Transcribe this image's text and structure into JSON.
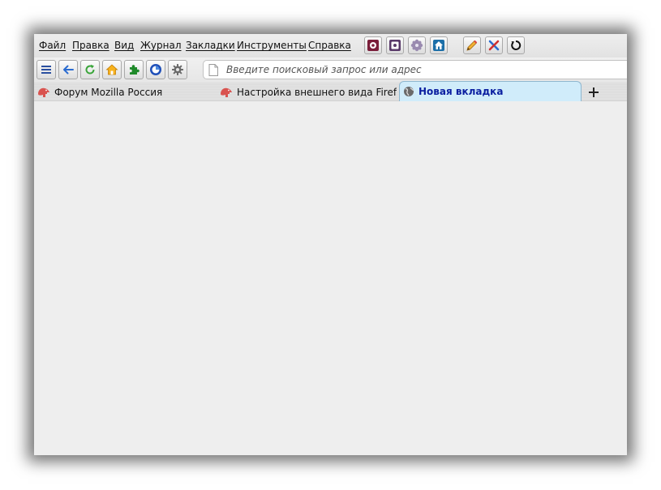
{
  "menu": {
    "items": [
      {
        "label": "Файл"
      },
      {
        "label": "Правка"
      },
      {
        "label": "Вид"
      },
      {
        "label": "Журнал"
      },
      {
        "label": "Закладки"
      },
      {
        "label": "Инструменты"
      },
      {
        "label": "Справка"
      }
    ]
  },
  "menu_toolbar": {
    "buttons": [
      {
        "icon": "settings-square-icon"
      },
      {
        "icon": "addons-square-icon"
      },
      {
        "icon": "gear-flower-icon"
      },
      {
        "icon": "home-box-icon"
      },
      {
        "icon": "pencil-icon"
      },
      {
        "icon": "tools-cross-icon"
      },
      {
        "icon": "restart-icon"
      }
    ]
  },
  "navbar": {
    "buttons": [
      {
        "icon": "menu-icon"
      },
      {
        "icon": "back-arrow-icon"
      },
      {
        "icon": "reload-icon"
      },
      {
        "icon": "home-icon"
      },
      {
        "icon": "puzzle-icon"
      },
      {
        "icon": "browser-logo-icon"
      },
      {
        "icon": "gear-icon"
      }
    ],
    "url_placeholder": "Введите поисковый запрос или адрес",
    "url_value": ""
  },
  "tabs": [
    {
      "label": "Форум Mozilla Россия",
      "icon": "dino-icon",
      "selected": false
    },
    {
      "label": "Настройка внешнего вида Firefo…",
      "icon": "dino-icon",
      "selected": false
    },
    {
      "label": "Новая вкладка",
      "icon": "globe-icon",
      "selected": true
    }
  ],
  "colors": {
    "selected_tab_bg": "#d0ecfa",
    "selected_tab_text": "#0a1ea0",
    "content_bg": "#eeeeee"
  }
}
